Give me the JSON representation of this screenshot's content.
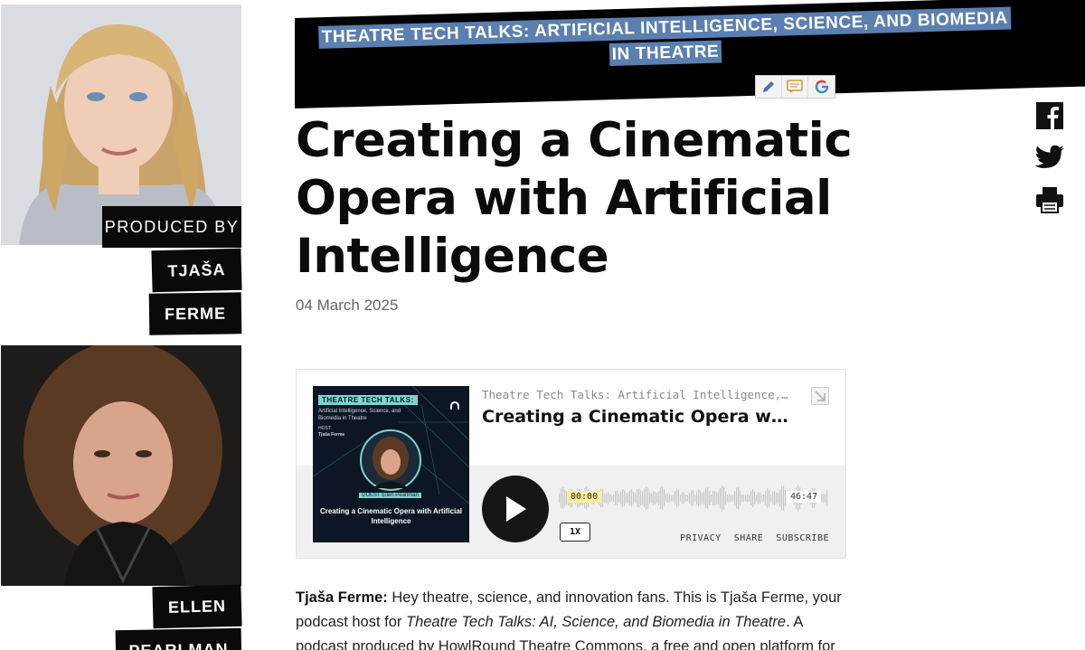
{
  "people": [
    {
      "label": "PRODUCED BY",
      "name_line1": "TJAŠA",
      "name_line2": "FERME"
    },
    {
      "name_line1": "ELLEN",
      "name_line2": "PEARLMAN"
    }
  ],
  "series_banner": "THEATRE TECH TALKS: ARTIFICIAL INTELLIGENCE, SCIENCE, AND BIOMEDIA IN THEATRE",
  "article": {
    "title": "Creating a Cinematic Opera with Artificial Intelligence",
    "date": "04 March 2025"
  },
  "toolbar_icons": [
    "pencil-icon",
    "comment-icon",
    "google-icon"
  ],
  "social_icons": [
    "facebook-icon",
    "twitter-icon",
    "print-icon"
  ],
  "player": {
    "cover": {
      "heading": "THEATRE TECH TALKS:",
      "subheading": "Artificial Intelligence, Science, and Biomedia in Theatre",
      "host_label": "HOST",
      "host_name": "Tjaša Ferme",
      "guest": "GUEST Ellen Pearlman",
      "episode": "Creating a Cinematic Opera with Artificial Intelligence"
    },
    "series": "Theatre Tech Talks: Artificial Intelligence, Science, and Biomedia in Theatre",
    "episode_title": "Creating a Cinematic Opera with Artificial Intelligence",
    "current_time": "00:00",
    "total_time": "46:47",
    "speed": "1X",
    "links": {
      "privacy": "PRIVACY",
      "share": "SHARE",
      "subscribe": "SUBSCRIBE"
    },
    "progress": 0
  },
  "body": {
    "speaker": "Tjaša Ferme:",
    "text1": " Hey theatre, science, and innovation fans. This is Tjaša Ferme, your podcast host for ",
    "show_italic": "Theatre Tech Talks: AI, Science, and Biomedia in Theatre",
    "text2": ". A podcast produced by HowlRound Theatre Commons, a free and open platform for"
  },
  "colors": {
    "banner_bg": "#000000",
    "highlight": "#5a7fb0",
    "time_highlight": "#f7f09a"
  }
}
